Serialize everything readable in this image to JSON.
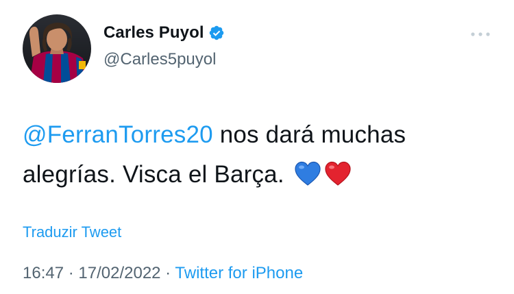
{
  "author": {
    "display_name": "Carles Puyol",
    "handle": "@Carles5puyol",
    "verified": true
  },
  "tweet": {
    "mention": "@FerranTorres20",
    "text_rest": " nos dará muchas alegrías. Visca el Barça.",
    "emojis": [
      "blue-heart",
      "red-heart"
    ]
  },
  "translate_label": "Traduzir Tweet",
  "meta": {
    "time": "16:47",
    "sep1": " · ",
    "date": "17/02/2022",
    "sep2": " · ",
    "source": "Twitter for iPhone"
  },
  "colors": {
    "accent": "#1d9bf0",
    "text": "#0f1419",
    "secondary": "#536471"
  }
}
